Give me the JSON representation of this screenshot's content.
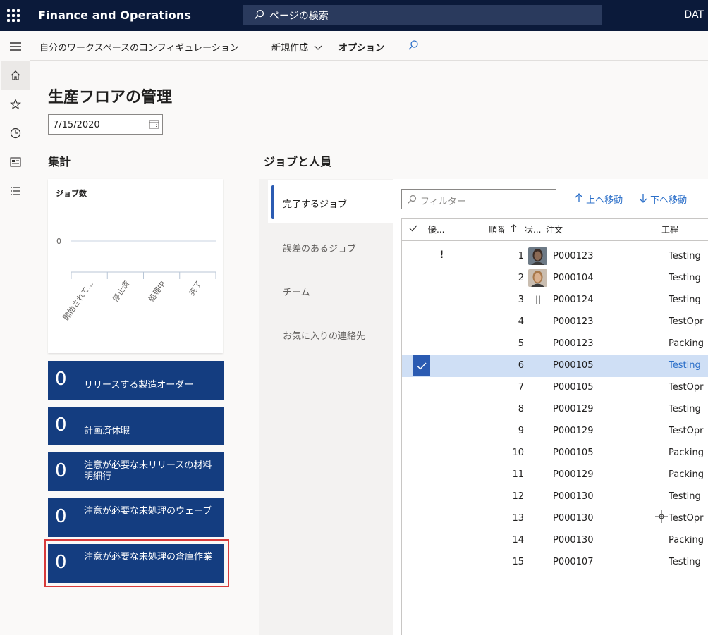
{
  "app": {
    "title": "Finance and Operations",
    "search_placeholder": "ページの検索",
    "company": "DAT"
  },
  "actionpane": {
    "workspace_config": "自分のワークスペースのコンフィギュレーション",
    "new": "新規作成",
    "options": "オプション"
  },
  "page": {
    "title": "生産フロアの管理",
    "date": "7/15/2020"
  },
  "summary": {
    "heading": "集計",
    "chart_title": "ジョブ数",
    "tiles": [
      {
        "count": "0",
        "label": "リリースする製造オーダー"
      },
      {
        "count": "0",
        "label": "計画済休暇"
      },
      {
        "count": "0",
        "label": "注意が必要な未リリースの材料明細行"
      },
      {
        "count": "0",
        "label": "注意が必要な未処理のウェーブ"
      },
      {
        "count": "0",
        "label": "注意が必要な未処理の倉庫作業"
      }
    ]
  },
  "chart_data": {
    "type": "bar",
    "title": "ジョブ数",
    "categories": [
      "開始されて...",
      "停止済",
      "処理中",
      "完了"
    ],
    "values": [
      0,
      0,
      0,
      0
    ],
    "yticks": [
      "0"
    ],
    "ylim": [
      0,
      1
    ]
  },
  "jobs": {
    "heading": "ジョブと人員",
    "tabs": [
      "完了するジョブ",
      "誤差のあるジョブ",
      "チーム",
      "お気に入りの連絡先"
    ],
    "filter_placeholder": "フィルター",
    "move_up": "上へ移動",
    "move_down": "下へ移動",
    "columns": {
      "priority": "優...",
      "sequence": "順番",
      "state": "状...",
      "order": "注文",
      "operation": "工程"
    },
    "rows": [
      {
        "seq": "1",
        "order": "P000123",
        "operation": "Testing",
        "priority": "!",
        "avatar": "avatar-1"
      },
      {
        "seq": "2",
        "order": "P000104",
        "operation": "Testing",
        "avatar": "avatar-2"
      },
      {
        "seq": "3",
        "order": "P000124",
        "operation": "Testing",
        "state": "||"
      },
      {
        "seq": "4",
        "order": "P000123",
        "operation": "TestOpr"
      },
      {
        "seq": "5",
        "order": "P000123",
        "operation": "Packing"
      },
      {
        "seq": "6",
        "order": "P000105",
        "operation": "Testing",
        "selected": true
      },
      {
        "seq": "7",
        "order": "P000105",
        "operation": "TestOpr"
      },
      {
        "seq": "8",
        "order": "P000129",
        "operation": "Testing"
      },
      {
        "seq": "9",
        "order": "P000129",
        "operation": "TestOpr"
      },
      {
        "seq": "10",
        "order": "P000105",
        "operation": "Packing"
      },
      {
        "seq": "11",
        "order": "P000129",
        "operation": "Packing"
      },
      {
        "seq": "12",
        "order": "P000130",
        "operation": "Testing"
      },
      {
        "seq": "13",
        "order": "P000130",
        "operation": "TestOpr"
      },
      {
        "seq": "14",
        "order": "P000130",
        "operation": "Packing"
      },
      {
        "seq": "15",
        "order": "P000107",
        "operation": "Testing"
      }
    ]
  }
}
